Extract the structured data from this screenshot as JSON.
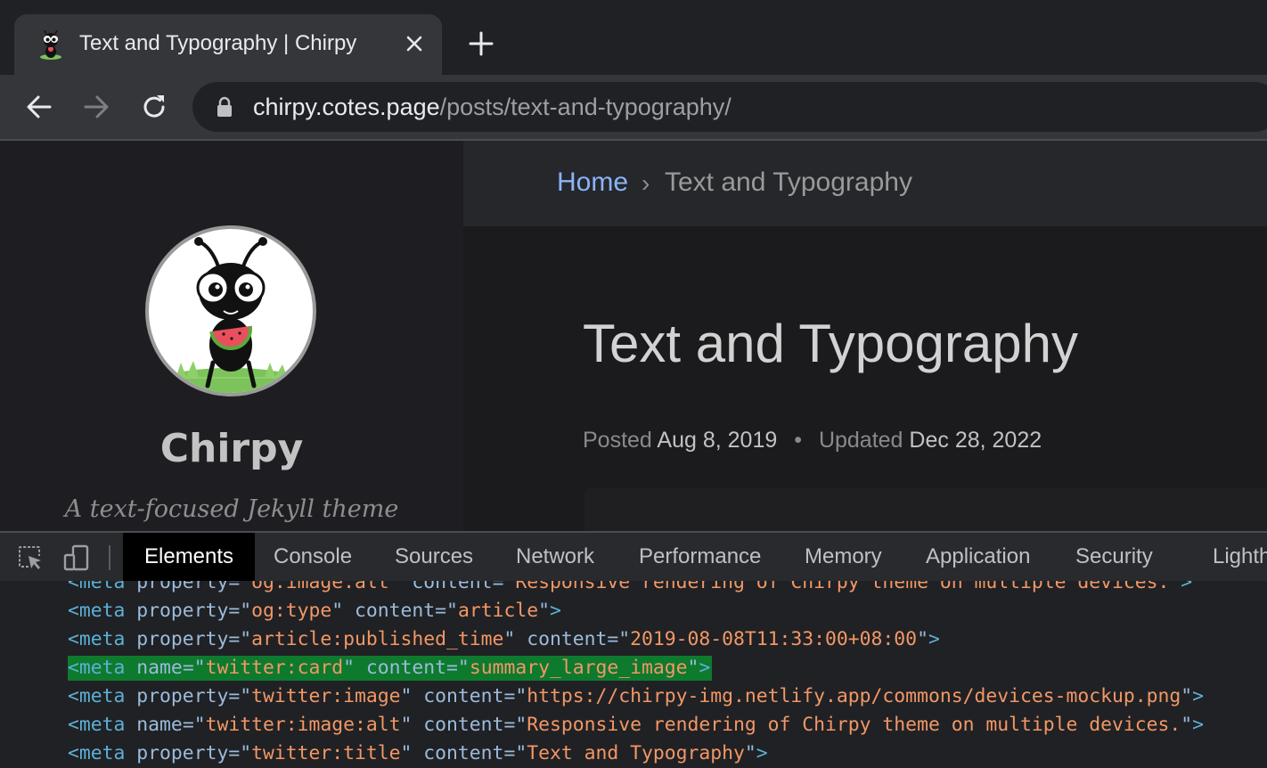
{
  "browser": {
    "tab_title": "Text and Typography | Chirpy",
    "url_host": "chirpy.cotes.page",
    "url_path": "/posts/text-and-typography/"
  },
  "page": {
    "breadcrumb_home": "Home",
    "breadcrumb_sep": "›",
    "breadcrumb_current": "Text and Typography",
    "site_title": "Chirpy",
    "site_subtitle": "A text-focused Jekyll theme",
    "post_title": "Text and Typography",
    "posted_label": "Posted",
    "posted_date": "Aug 8, 2019",
    "meta_dot": "•",
    "updated_label": "Updated",
    "updated_date": "Dec 28, 2022"
  },
  "devtools": {
    "tabs": [
      "Elements",
      "Console",
      "Sources",
      "Network",
      "Performance",
      "Memory",
      "Application",
      "Security",
      "Lighthouse"
    ],
    "active_tab": "Elements",
    "dom_lines": [
      {
        "tag": "meta",
        "attr1": "property",
        "val1": "og:image:alt",
        "attr2": "content",
        "val2": "Responsive rendering of Chirpy theme on multiple devices."
      },
      {
        "tag": "meta",
        "attr1": "property",
        "val1": "og:type",
        "attr2": "content",
        "val2": "article"
      },
      {
        "tag": "meta",
        "attr1": "property",
        "val1": "article:published_time",
        "attr2": "content",
        "val2": "2019-08-08T11:33:00+08:00"
      },
      {
        "tag": "meta",
        "attr1": "name",
        "val1": "twitter:card",
        "attr2": "content",
        "val2": "summary_large_image",
        "selected": true
      },
      {
        "tag": "meta",
        "attr1": "property",
        "val1": "twitter:image",
        "attr2": "content",
        "val2": "https://chirpy-img.netlify.app/commons/devices-mockup.png"
      },
      {
        "tag": "meta",
        "attr1": "name",
        "val1": "twitter:image:alt",
        "attr2": "content",
        "val2": "Responsive rendering of Chirpy theme on multiple devices."
      },
      {
        "tag": "meta",
        "attr1": "property",
        "val1": "twitter:title",
        "attr2": "content",
        "val2": "Text and Typography"
      }
    ]
  },
  "colors": {
    "link": "#8ab4f8",
    "dom_tag": "#5db0d7",
    "dom_attr_value": "#f29766",
    "dom_selected_bg": "#0e7a2e"
  },
  "icons": [
    "ant-favicon-icon",
    "close-icon",
    "plus-icon",
    "back-arrow-icon",
    "forward-arrow-icon",
    "reload-icon",
    "lock-icon",
    "inspect-element-icon",
    "device-toolbar-icon",
    "ant-avatar-image"
  ]
}
